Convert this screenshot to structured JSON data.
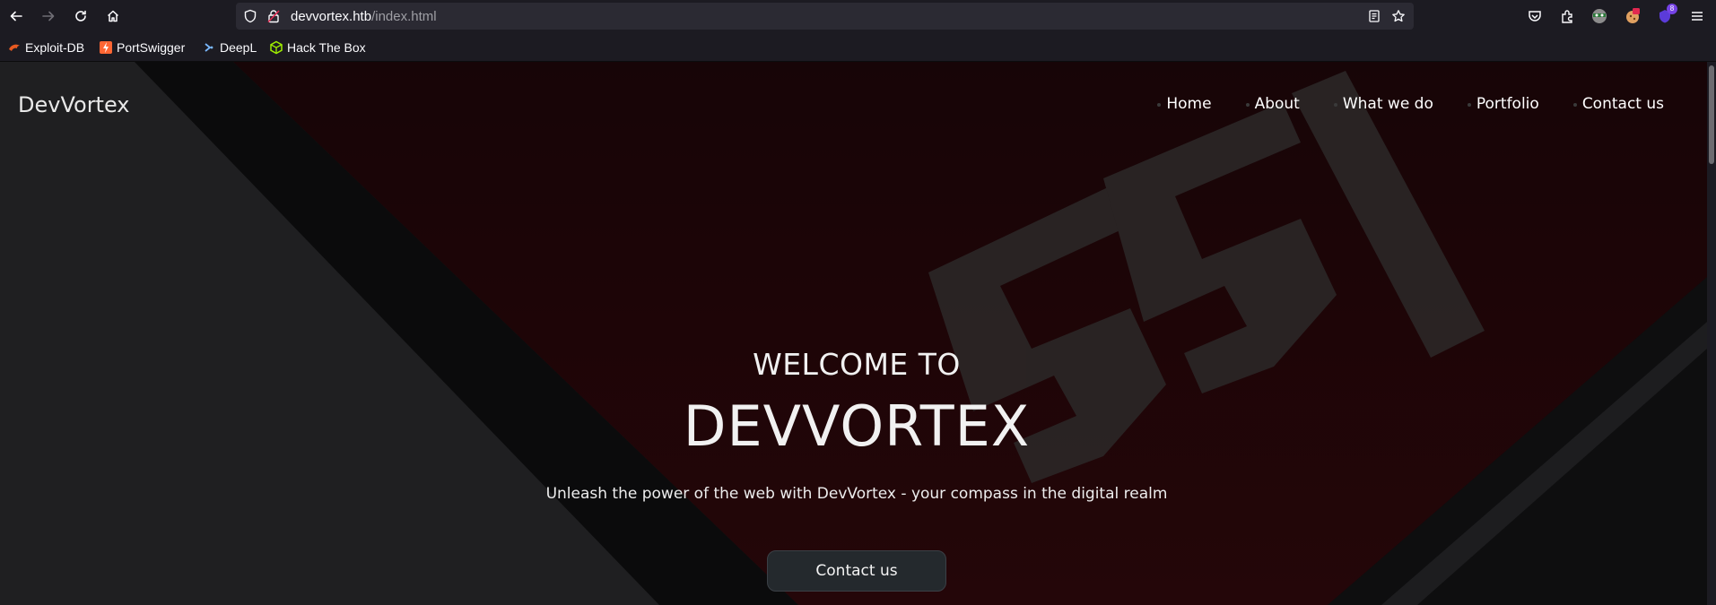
{
  "browser": {
    "url_host": "devvortex.htb",
    "url_path": "/index.html",
    "extension_badge": "8",
    "bookmarks": [
      {
        "label": "Exploit-DB",
        "icon": "exploitdb-icon"
      },
      {
        "label": "PortSwigger",
        "icon": "portswigger-icon"
      },
      {
        "label": "DeepL",
        "icon": "deepl-icon"
      },
      {
        "label": "Hack The Box",
        "icon": "hackthebox-icon"
      }
    ]
  },
  "site": {
    "brand": "DevVortex",
    "nav": [
      {
        "label": "Home"
      },
      {
        "label": "About"
      },
      {
        "label": "What we do"
      },
      {
        "label": "Portfolio"
      },
      {
        "label": "Contact us"
      }
    ],
    "hero": {
      "subtitle": "WELCOME TO",
      "title": "DEVVORTEX",
      "tagline": "Unleash the power of the web with DevVortex - your compass in the digital realm",
      "cta": "Contact us"
    }
  },
  "colors": {
    "chrome_bg": "#1c1b22",
    "urlbar_bg": "#2b2a33",
    "hero_red": "#2a0608",
    "button_bg": "#24292d"
  }
}
